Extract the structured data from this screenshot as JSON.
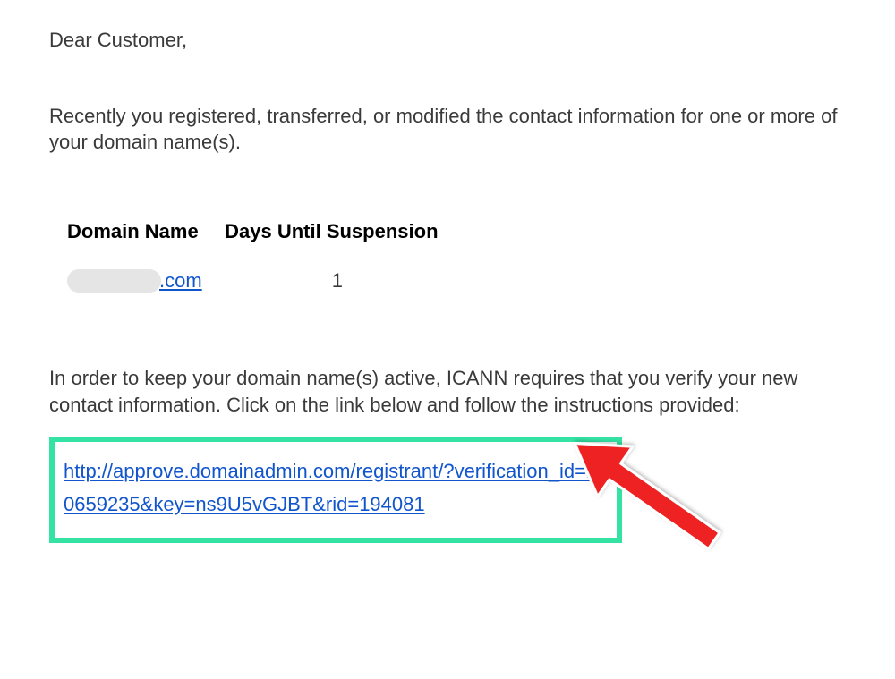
{
  "greeting": "Dear Customer,",
  "intro": "Recently you registered, transferred, or modified the contact information for one or more of your domain name(s).",
  "table": {
    "headers": {
      "domain": "Domain Name",
      "days": "Days Until Suspension"
    },
    "row": {
      "domain_suffix": ".com",
      "days_value": "1"
    }
  },
  "instruction": "In order to keep your domain name(s) active, ICANN requires that you verify your new contact information. Click on the link below and follow the instructions provided:",
  "verification_link": "http://approve.domainadmin.com/registrant/?verification_id=10659235&key=ns9U5vGJBT&rid=194081"
}
